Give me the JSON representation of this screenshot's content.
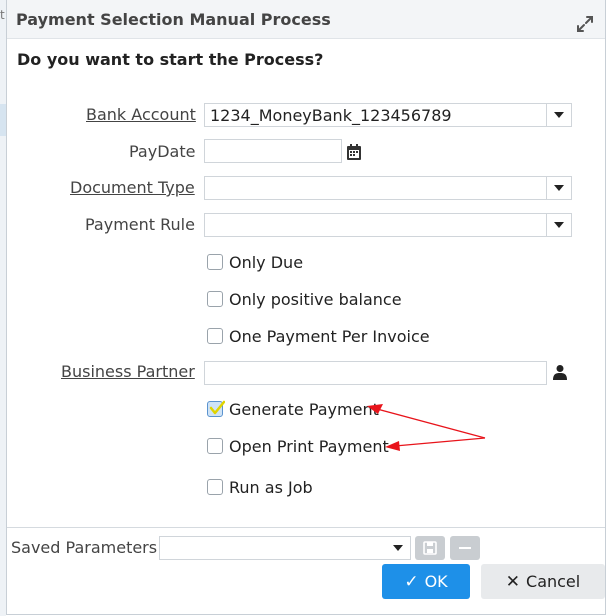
{
  "dialog": {
    "title": "Payment Selection Manual Process",
    "question": "Do you want to start the Process?"
  },
  "fields": {
    "bank_account": {
      "label": "Bank Account",
      "value": "1234_MoneyBank_123456789"
    },
    "pay_date": {
      "label": "PayDate",
      "value": ""
    },
    "document_type": {
      "label": "Document Type",
      "value": ""
    },
    "payment_rule": {
      "label": "Payment Rule",
      "value": ""
    },
    "business_partner": {
      "label": "Business Partner",
      "value": ""
    }
  },
  "checkboxes": [
    {
      "label": "Only Due",
      "checked": false
    },
    {
      "label": "Only positive balance",
      "checked": false
    },
    {
      "label": "One Payment Per Invoice",
      "checked": false
    },
    {
      "label": "Generate Payment",
      "checked": true
    },
    {
      "label": "Open Print Payment",
      "checked": false
    },
    {
      "label": "Run as Job",
      "checked": false
    }
  ],
  "footer": {
    "saved_parameters_label": "Saved Parameters",
    "saved_parameters_value": "",
    "ok_label": "OK",
    "cancel_label": "Cancel"
  },
  "colors": {
    "accent": "#1e90e8",
    "annotation_arrow": "#e8141b",
    "check_mark": "#e0d400"
  },
  "background": {
    "edge_text": "t"
  }
}
